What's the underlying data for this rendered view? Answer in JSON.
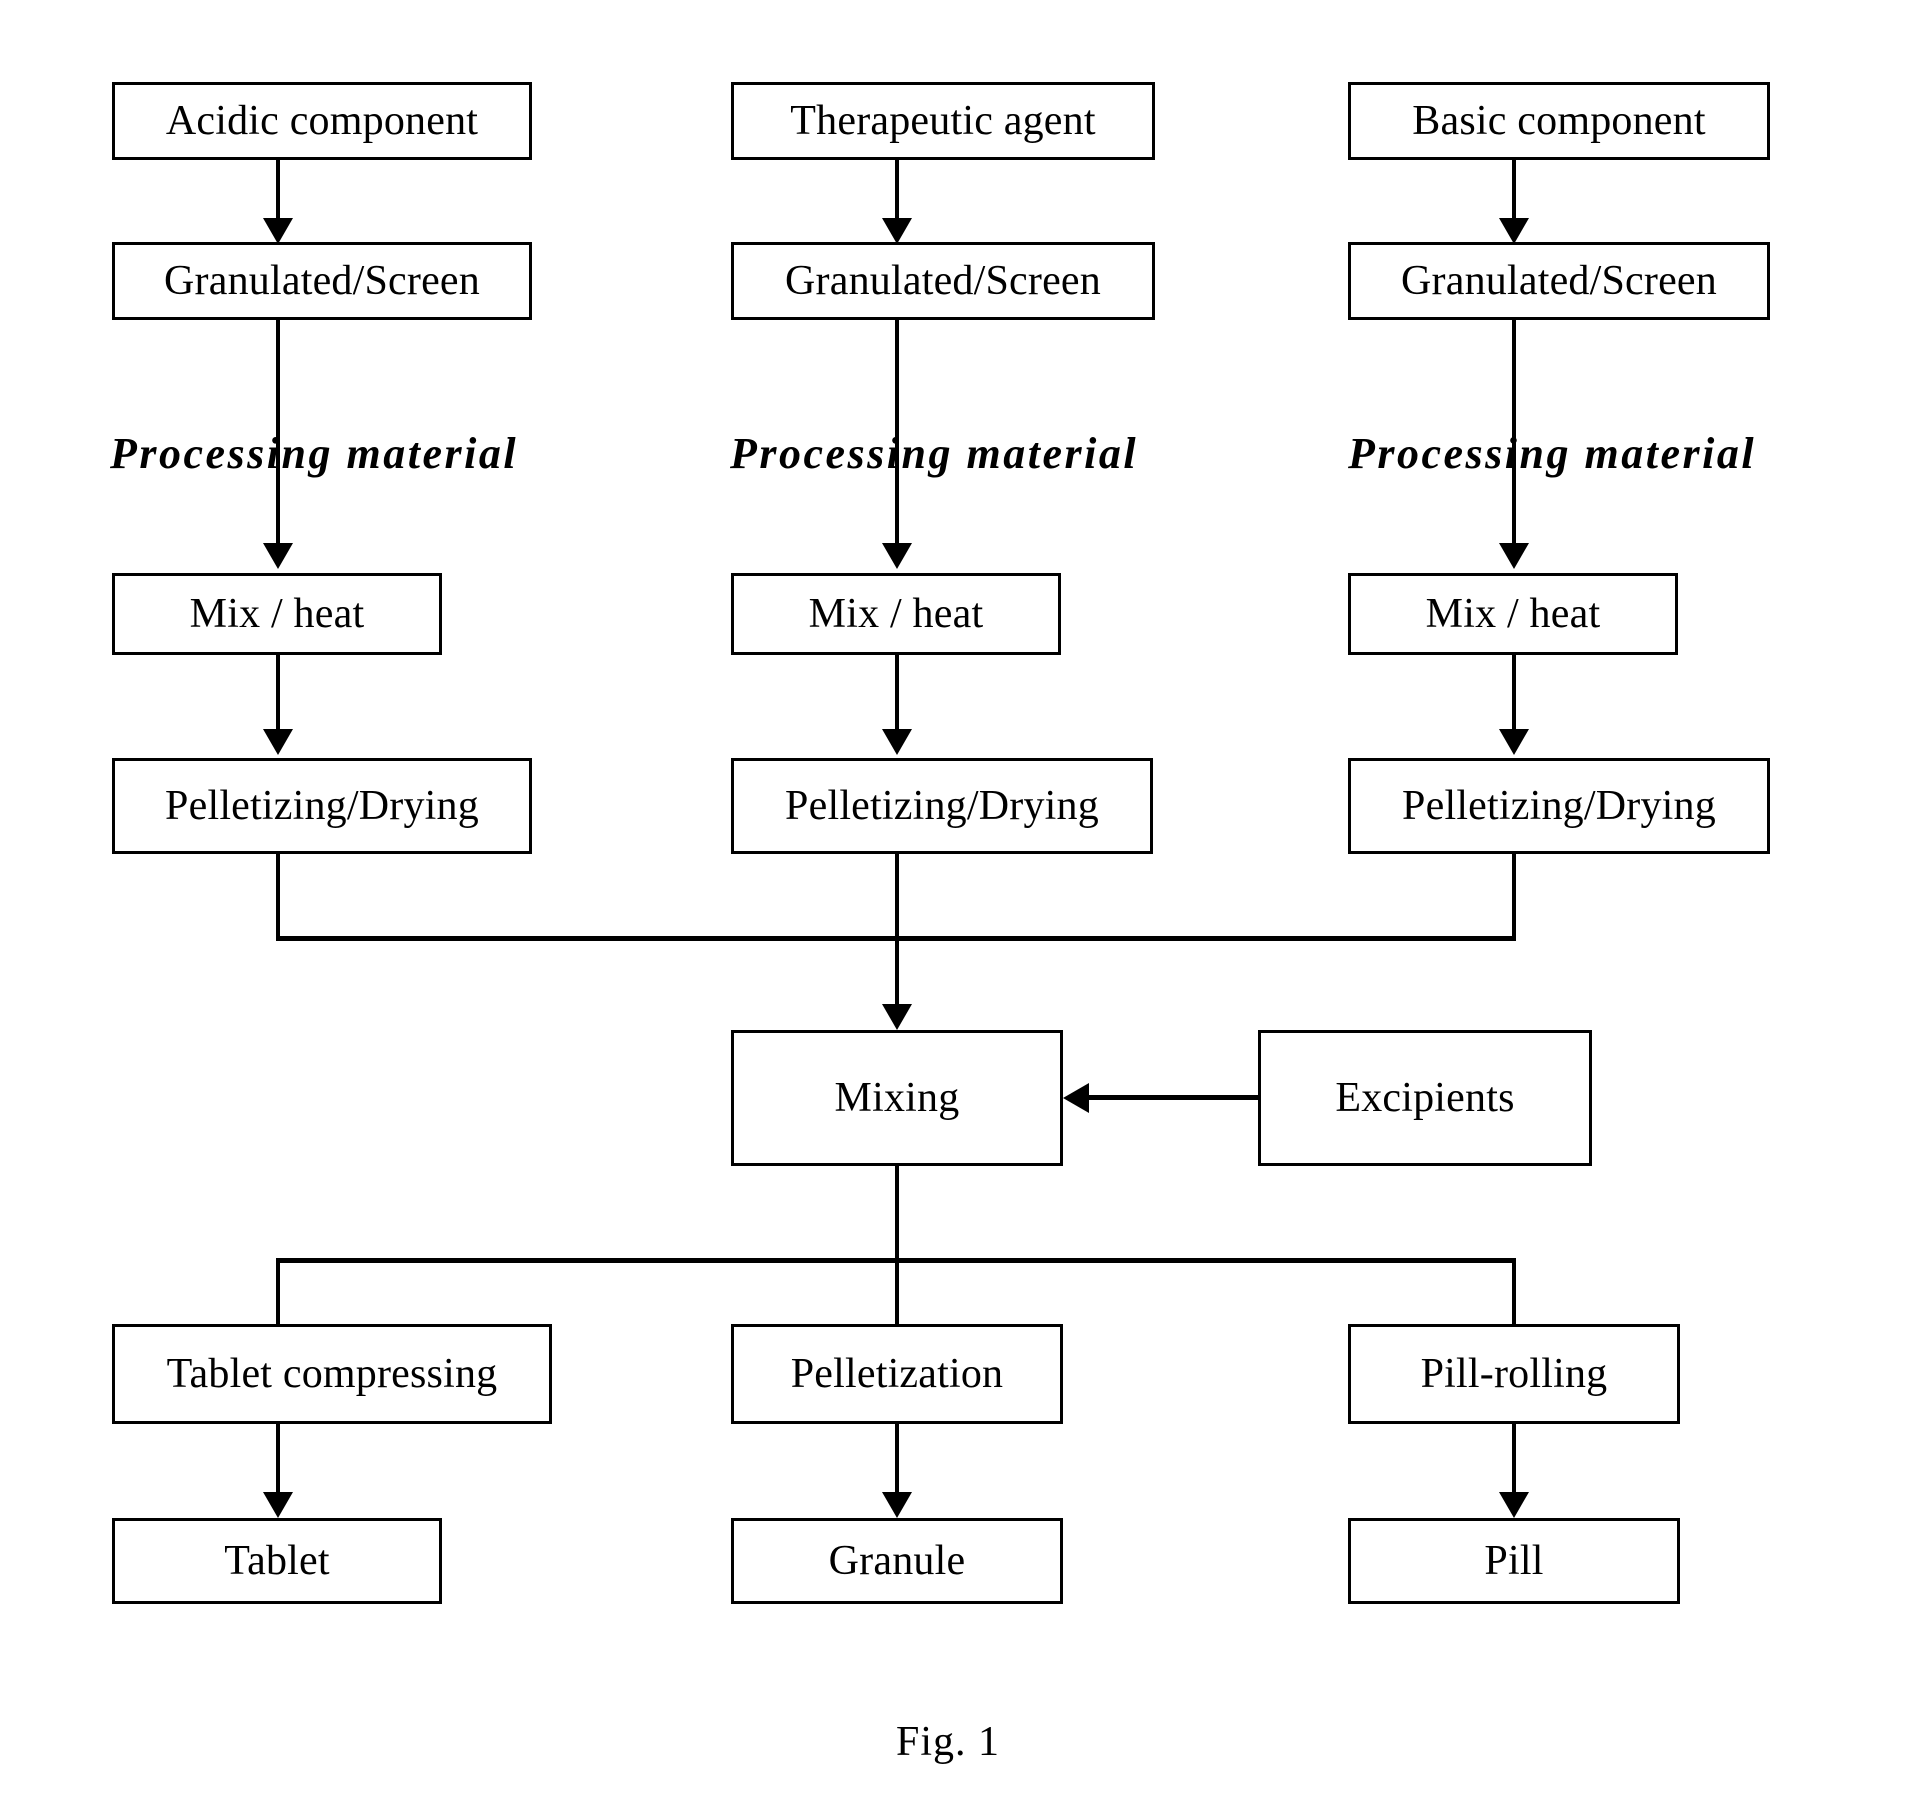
{
  "figure": {
    "caption": "Fig. 1",
    "annotation_label": "Processing material"
  },
  "columns": [
    {
      "id": "acidic",
      "annotation": "Processing material"
    },
    {
      "id": "therapeutic",
      "annotation": "Processing material"
    },
    {
      "id": "basic",
      "annotation": "Processing material"
    }
  ],
  "nodes": {
    "acidic_component": "Acidic component",
    "therapeutic_agent": "Therapeutic agent",
    "basic_component": "Basic component",
    "granulated_screen_left": "Granulated/Screen",
    "granulated_screen_center": "Granulated/Screen",
    "granulated_screen_right": "Granulated/Screen",
    "mix_heat_left": "Mix / heat",
    "mix_heat_center": "Mix / heat",
    "mix_heat_right": "Mix / heat",
    "pelletizing_drying_left": "Pelletizing/Drying",
    "pelletizing_drying_center": "Pelletizing/Drying",
    "pelletizing_drying_right": "Pelletizing/Drying",
    "mixing": "Mixing",
    "excipients": "Excipients",
    "tablet_compressing": "Tablet compressing",
    "pelletization": "Pelletization",
    "pill_rolling": "Pill-rolling",
    "tablet": "Tablet",
    "granule": "Granule",
    "pill": "Pill"
  },
  "colors": {
    "stroke": "#000000",
    "fill": "#ffffff",
    "text": "#000000"
  }
}
